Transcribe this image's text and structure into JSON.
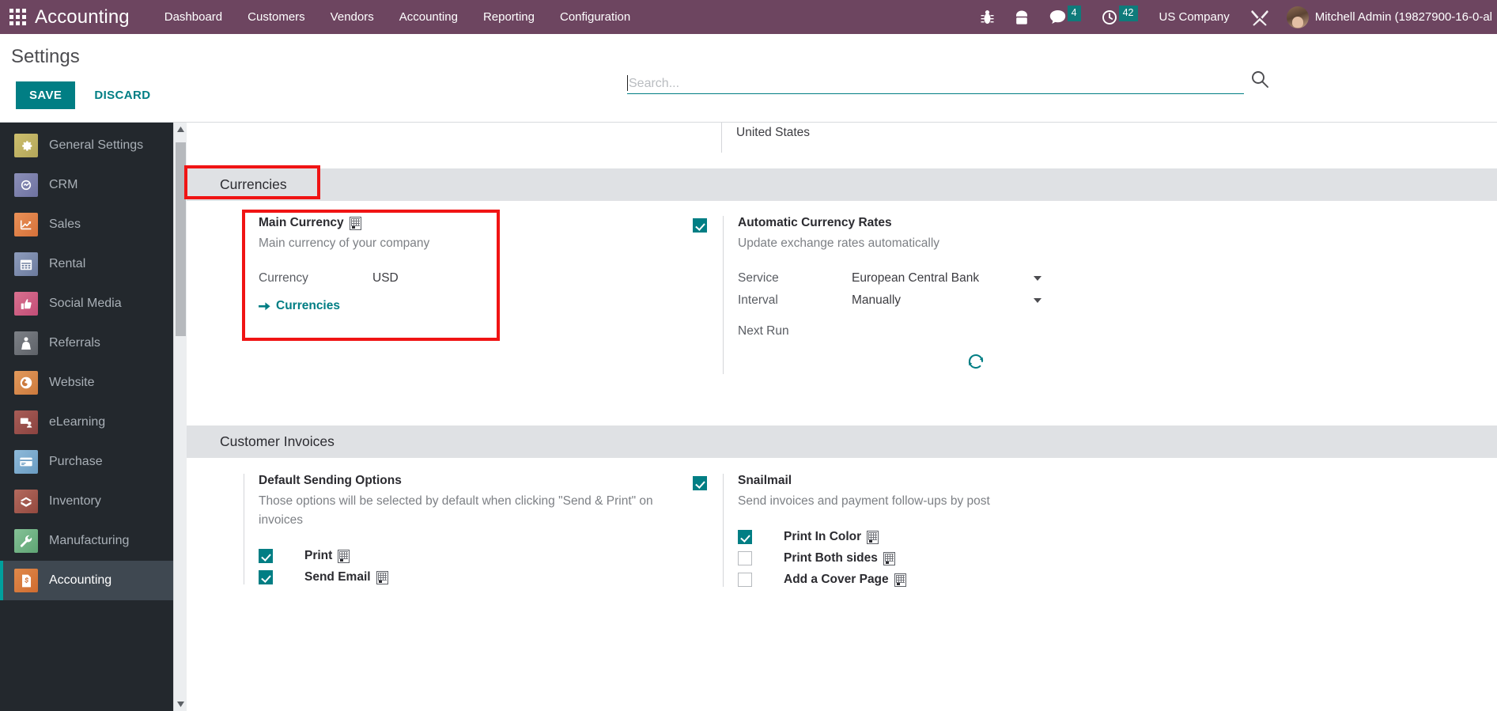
{
  "navbar": {
    "apps_icon": "apps-grid-icon",
    "brand": "Accounting",
    "menu": [
      {
        "label": "Dashboard"
      },
      {
        "label": "Customers"
      },
      {
        "label": "Vendors"
      },
      {
        "label": "Accounting"
      },
      {
        "label": "Reporting"
      },
      {
        "label": "Configuration"
      }
    ],
    "right": {
      "bug_icon": "bug-icon",
      "phone_icon": "phone-icon",
      "messages_icon": "chat-bubble-icon",
      "messages_count": "4",
      "activities_icon": "clock-icon",
      "activities_count": "42",
      "company": "US Company",
      "tools_icon": "wrench-tools-icon",
      "avatar": "user-avatar",
      "user": "Mitchell Admin (19827900-16-0-al"
    }
  },
  "control_panel": {
    "title": "Settings",
    "save_label": "SAVE",
    "discard_label": "DISCARD",
    "search_placeholder": "Search...",
    "search_value": "",
    "search_icon": "search-icon"
  },
  "sidebar": {
    "items": [
      {
        "label": "General Settings",
        "icon": "gear-icon",
        "color": "#c3b668",
        "active": false
      },
      {
        "label": "CRM",
        "icon": "handshake-icon",
        "color": "#7b7fae",
        "active": false
      },
      {
        "label": "Sales",
        "icon": "chart-up-icon",
        "color": "#e0803f",
        "active": false
      },
      {
        "label": "Rental",
        "icon": "calendar-icon",
        "color": "#7d8cad",
        "active": false
      },
      {
        "label": "Social Media",
        "icon": "thumbs-up-icon",
        "color": "#cf5d84",
        "active": false
      },
      {
        "label": "Referrals",
        "icon": "person-gift-icon",
        "color": "#6d7176",
        "active": false
      },
      {
        "label": "Website",
        "icon": "globe-icon",
        "color": "#d98a4e",
        "active": false
      },
      {
        "label": "eLearning",
        "icon": "presentation-icon",
        "color": "#9b4f4a",
        "active": false
      },
      {
        "label": "Purchase",
        "icon": "credit-card-icon",
        "color": "#76a9cc",
        "active": false
      },
      {
        "label": "Inventory",
        "icon": "box-open-icon",
        "color": "#a6584f",
        "active": false
      },
      {
        "label": "Manufacturing",
        "icon": "wrench-icon",
        "color": "#71b383",
        "active": false
      },
      {
        "label": "Accounting",
        "icon": "invoice-dollar-icon",
        "color": "#d9793b",
        "active": true
      }
    ],
    "scroll_up_icon": "chevron-up-icon",
    "scroll_down_icon": "chevron-down-icon"
  },
  "main": {
    "top_fragment": "United States",
    "sections": [
      {
        "title": "Currencies",
        "left": {
          "title": "Main Currency",
          "title_icon": "company-building-icon",
          "desc": "Main currency of your company",
          "field_label": "Currency",
          "field_value": "USD",
          "link_label": "Currencies",
          "link_icon": "arrow-right-icon"
        },
        "right": {
          "checked": true,
          "title": "Automatic Currency Rates",
          "desc": "Update exchange rates automatically",
          "rows": [
            {
              "label": "Service",
              "value": "European Central Bank",
              "type": "select"
            },
            {
              "label": "Interval",
              "value": "Manually",
              "type": "select"
            },
            {
              "label": "Next Run",
              "value": "",
              "type": "text"
            }
          ],
          "refresh_icon": "refresh-icon"
        }
      },
      {
        "title": "Customer Invoices",
        "left": {
          "title": "Default Sending Options",
          "desc": "Those options will be selected by default when clicking \"Send & Print\" on invoices",
          "options": [
            {
              "label": "Print",
              "checked": true,
              "icon": "company-building-icon"
            },
            {
              "label": "Send Email",
              "checked": true,
              "icon": "company-building-icon"
            }
          ]
        },
        "right": {
          "checked": true,
          "title": "Snailmail",
          "desc": "Send invoices and payment follow-ups by post",
          "options": [
            {
              "label": "Print In Color",
              "checked": true,
              "icon": "company-building-icon"
            },
            {
              "label": "Print Both sides",
              "checked": false,
              "icon": "company-building-icon"
            },
            {
              "label": "Add a Cover Page",
              "checked": false,
              "icon": "company-building-icon"
            }
          ]
        }
      }
    ]
  },
  "annotations": {
    "highlight_color": "#f01414",
    "boxes": [
      {
        "name": "currencies-section-highlight"
      },
      {
        "name": "main-currency-card-highlight"
      }
    ]
  }
}
